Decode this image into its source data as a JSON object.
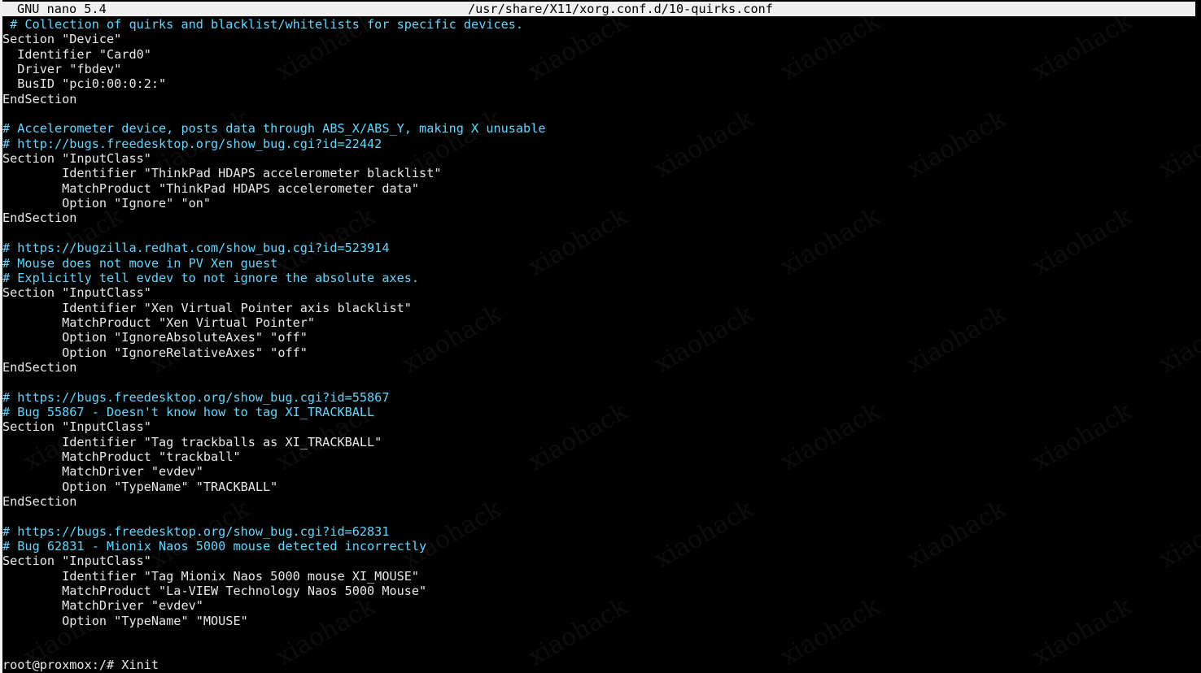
{
  "titlebar": {
    "app_name": "GNU nano 5.4",
    "file_path": "/usr/share/X11/xorg.conf.d/10-quirks.conf"
  },
  "editor": {
    "lines": [
      {
        "text": " # Collection of quirks and blacklist/whitelists for specific devices.",
        "kind": "comment"
      },
      {
        "text": "Section \"Device\"",
        "kind": "code"
      },
      {
        "text": "  Identifier \"Card0\"",
        "kind": "code"
      },
      {
        "text": "  Driver \"fbdev\"",
        "kind": "code"
      },
      {
        "text": "  BusID \"pci0:00:0:2:\"",
        "kind": "code"
      },
      {
        "text": "EndSection",
        "kind": "code"
      },
      {
        "text": "",
        "kind": "code"
      },
      {
        "text": "# Accelerometer device, posts data through ABS_X/ABS_Y, making X unusable",
        "kind": "comment"
      },
      {
        "text": "# http://bugs.freedesktop.org/show_bug.cgi?id=22442",
        "kind": "comment"
      },
      {
        "text": "Section \"InputClass\"",
        "kind": "code"
      },
      {
        "text": "        Identifier \"ThinkPad HDAPS accelerometer blacklist\"",
        "kind": "code"
      },
      {
        "text": "        MatchProduct \"ThinkPad HDAPS accelerometer data\"",
        "kind": "code"
      },
      {
        "text": "        Option \"Ignore\" \"on\"",
        "kind": "code"
      },
      {
        "text": "EndSection",
        "kind": "code"
      },
      {
        "text": "",
        "kind": "code"
      },
      {
        "text": "# https://bugzilla.redhat.com/show_bug.cgi?id=523914",
        "kind": "comment"
      },
      {
        "text": "# Mouse does not move in PV Xen guest",
        "kind": "comment"
      },
      {
        "text": "# Explicitly tell evdev to not ignore the absolute axes.",
        "kind": "comment"
      },
      {
        "text": "Section \"InputClass\"",
        "kind": "code"
      },
      {
        "text": "        Identifier \"Xen Virtual Pointer axis blacklist\"",
        "kind": "code"
      },
      {
        "text": "        MatchProduct \"Xen Virtual Pointer\"",
        "kind": "code"
      },
      {
        "text": "        Option \"IgnoreAbsoluteAxes\" \"off\"",
        "kind": "code"
      },
      {
        "text": "        Option \"IgnoreRelativeAxes\" \"off\"",
        "kind": "code"
      },
      {
        "text": "EndSection",
        "kind": "code"
      },
      {
        "text": "",
        "kind": "code"
      },
      {
        "text": "# https://bugs.freedesktop.org/show_bug.cgi?id=55867",
        "kind": "comment"
      },
      {
        "text": "# Bug 55867 - Doesn't know how to tag XI_TRACKBALL",
        "kind": "comment"
      },
      {
        "text": "Section \"InputClass\"",
        "kind": "code"
      },
      {
        "text": "        Identifier \"Tag trackballs as XI_TRACKBALL\"",
        "kind": "code"
      },
      {
        "text": "        MatchProduct \"trackball\"",
        "kind": "code"
      },
      {
        "text": "        MatchDriver \"evdev\"",
        "kind": "code"
      },
      {
        "text": "        Option \"TypeName\" \"TRACKBALL\"",
        "kind": "code"
      },
      {
        "text": "EndSection",
        "kind": "code"
      },
      {
        "text": "",
        "kind": "code"
      },
      {
        "text": "# https://bugs.freedesktop.org/show_bug.cgi?id=62831",
        "kind": "comment"
      },
      {
        "text": "# Bug 62831 - Mionix Naos 5000 mouse detected incorrectly",
        "kind": "comment"
      },
      {
        "text": "Section \"InputClass\"",
        "kind": "code"
      },
      {
        "text": "        Identifier \"Tag Mionix Naos 5000 mouse XI_MOUSE\"",
        "kind": "code"
      },
      {
        "text": "        MatchProduct \"La-VIEW Technology Naos 5000 Mouse\"",
        "kind": "code"
      },
      {
        "text": "        MatchDriver \"evdev\"",
        "kind": "code"
      },
      {
        "text": "        Option \"TypeName\" \"MOUSE\"",
        "kind": "code"
      }
    ]
  },
  "shell": {
    "prompt": "root@proxmox:/# Xinit"
  },
  "watermark": {
    "text": "xiaohack"
  },
  "colors": {
    "background": "#000000",
    "text": "#e8e8e8",
    "comment": "#5fd7ff",
    "titlebar_bg": "#f0f0f0",
    "titlebar_fg": "#000000"
  }
}
